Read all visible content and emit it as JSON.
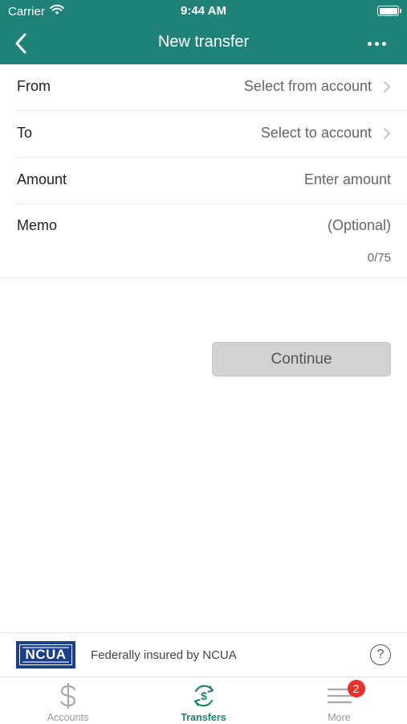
{
  "status_bar": {
    "carrier": "Carrier",
    "time": "9:44 AM"
  },
  "nav": {
    "title": "New transfer"
  },
  "form": {
    "from": {
      "label": "From",
      "value": "Select from account"
    },
    "to": {
      "label": "To",
      "value": "Select to account"
    },
    "amount": {
      "label": "Amount",
      "placeholder": "Enter amount"
    },
    "memo": {
      "label": "Memo",
      "placeholder": "(Optional)",
      "counter": "0/75"
    }
  },
  "continue_label": "Continue",
  "footer": {
    "logo_text": "NCUA",
    "insured_text": "Federally insured by NCUA",
    "help_label": "?"
  },
  "tabs": [
    {
      "label": "Accounts",
      "icon": "dollar-icon",
      "active": false
    },
    {
      "label": "Transfers",
      "icon": "transfer-dollar-icon",
      "active": true
    },
    {
      "label": "More",
      "icon": "menu-icon",
      "active": false,
      "badge": "2"
    }
  ],
  "colors": {
    "header": "#1f8278",
    "accent": "#1f8278",
    "badge": "#e8302c",
    "button_disabled": "#d2d2d2",
    "ncua_blue": "#1b3f8a"
  }
}
